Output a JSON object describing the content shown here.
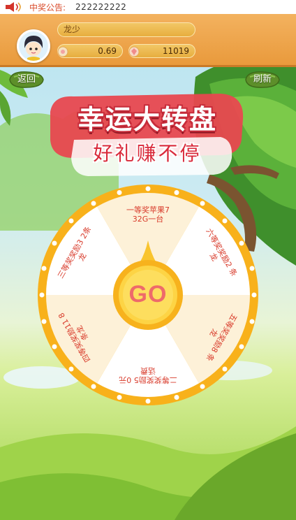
{
  "notice": {
    "label": "中奖公告:",
    "message": "222222222",
    "icon": "speaker-icon"
  },
  "user": {
    "name": "龙少",
    "coins": "0.69",
    "gems": "11019",
    "coin_icon": "coin-icon",
    "gem_icon": "gem-icon"
  },
  "buttons": {
    "back": "返回",
    "refresh": "刷新"
  },
  "title": {
    "main": "幸运大转盘",
    "sub": "好礼赚不停"
  },
  "wheel": {
    "go_label": "GO",
    "prizes": [
      "一等奖苹果7 32G一台",
      "六等奖奖励2 条龙",
      "五等奖奖励8 条龙",
      "二等奖奖励5 0元话费",
      "四等奖奖励11 8条龙",
      "三等奖奖励3 2条龙"
    ]
  },
  "colors": {
    "ring": "#f8b11b",
    "slice_light": "#ffffff",
    "slice_tint": "#fdf1d8",
    "prize_text": "#d83a2a",
    "header": "#ef9f41"
  }
}
